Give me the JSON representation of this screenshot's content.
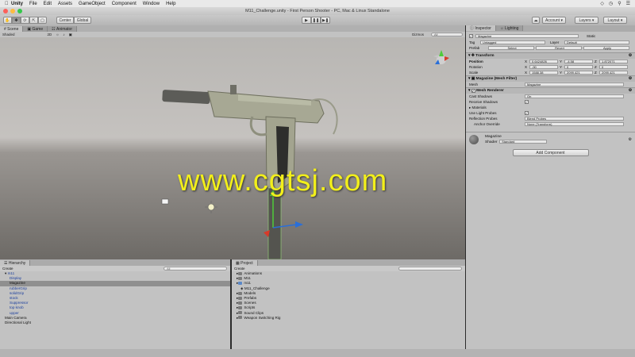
{
  "menubar": {
    "items": [
      "Unity",
      "File",
      "Edit",
      "Assets",
      "GameObject",
      "Component",
      "Window",
      "Help"
    ]
  },
  "window": {
    "title": "M11_Challenge.unity - First Person Shooter - PC, Mac & Linux Standalone"
  },
  "toolbar": {
    "pivot_label": "Center",
    "space_label": "Global",
    "account_label": "Account",
    "layers_label": "Layers",
    "layout_label": "Layout"
  },
  "scene": {
    "tabs": [
      "Scene",
      "Game",
      "Animator"
    ],
    "shading_label": "Shaded",
    "mode_2d": "2D",
    "gizmos_label": "Gizmos",
    "search_placeholder": "All"
  },
  "watermark": {
    "text": "www.cgtsj.com"
  },
  "inspector": {
    "tabs": [
      "Inspector",
      "Lighting"
    ],
    "object_name": "Magazine",
    "static_label": "Static",
    "tag_label": "Tag",
    "tag_value": "Untagged",
    "layer_label": "Layer",
    "layer_value": "Default",
    "prefab_label": "Prefab",
    "prefab_buttons": [
      "Select",
      "Revert",
      "Apply"
    ],
    "transform": {
      "title": "Transform",
      "position_label": "Position",
      "position": [
        "0.6424826",
        "-4.58",
        "1.872071"
      ],
      "rotation_label": "Rotation",
      "rotation": [
        "-90",
        "0",
        "0"
      ],
      "scale_label": "Scale",
      "scale": [
        "1588.38",
        "2099.421",
        "2099.421"
      ]
    },
    "mesh_filter": {
      "title": "Magazine (Mesh Filter)",
      "mesh_label": "Mesh",
      "mesh_value": "Magazine"
    },
    "mesh_renderer": {
      "title": "Mesh Renderer",
      "cast_shadows_label": "Cast Shadows",
      "cast_shadows_value": "On",
      "receive_shadows_label": "Receive Shadows",
      "materials_label": "Materials",
      "light_probes_label": "Use Light Probes",
      "reflection_probes_label": "Reflection Probes",
      "reflection_probes_value": "Blend Probes",
      "anchor_override_label": "Anchor Override",
      "anchor_override_value": "None (Transform)"
    },
    "material": {
      "name": "Magazine",
      "shader_label": "Shader",
      "shader_value": "Standard"
    },
    "add_component_label": "Add Component"
  },
  "hierarchy": {
    "title": "Hierarchy",
    "create_label": "Create",
    "search_placeholder": "All",
    "root": "m11",
    "children": [
      "Display",
      "Magazine",
      "rubberGrip",
      "solidGrip",
      "stock",
      "Suppressor",
      "top knob",
      "upper"
    ],
    "selected": "Magazine",
    "others": [
      "Main Camera",
      "Directional Light"
    ]
  },
  "project": {
    "title": "Project",
    "create_label": "Create",
    "items": [
      "Animations",
      "M11",
      "m11",
      "M11_Challenge",
      "Models",
      "Prefabs",
      "Scenes",
      "Scripts",
      "Sound Clips",
      "Weapon Switching Rig"
    ]
  }
}
